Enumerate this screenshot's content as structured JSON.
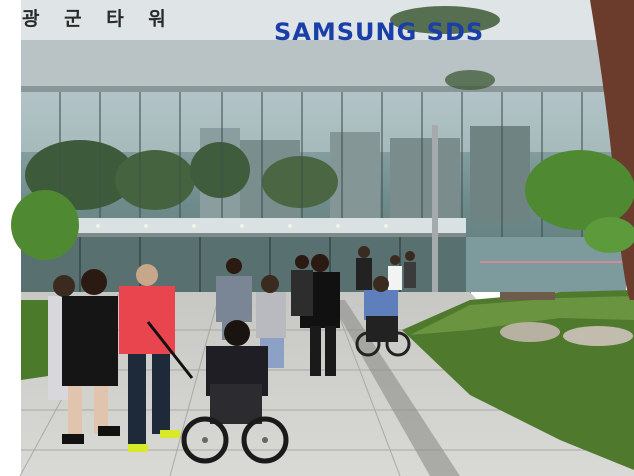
{
  "scene": {
    "sign_korean": "광 군 타 워",
    "sign_brand": "SAMSUNG SDS",
    "colors": {
      "sky": "#dfe6ea",
      "glass": "#7f9aa0",
      "pavement": "#cfcfcc",
      "hedge": "#4f7a2e",
      "brand_blue": "#1a3fa8",
      "red_shirt": "#e8454e"
    }
  }
}
